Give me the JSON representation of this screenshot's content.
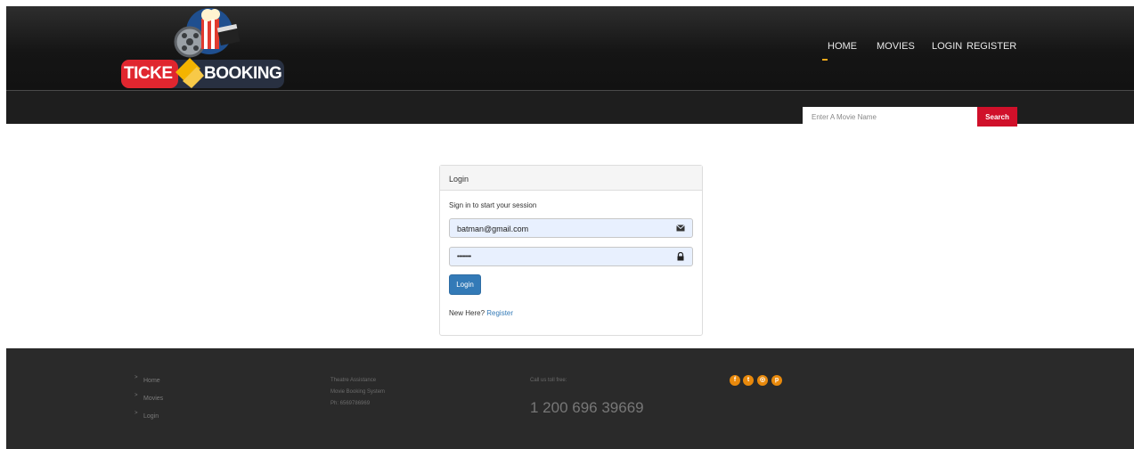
{
  "brand": {
    "logo_text_left": "TICKE",
    "logo_text_right": "BOOKING"
  },
  "nav": {
    "items": [
      "HOME",
      "MOVIES",
      "LOGIN",
      "REGISTER"
    ],
    "active": "HOME"
  },
  "search": {
    "placeholder": "Enter A Movie Name",
    "button_label": "Search"
  },
  "login_panel": {
    "title": "Login",
    "subtitle": "Sign in to start your session",
    "email_value": "batman@gmail.com",
    "password_value": "••••••••",
    "submit_label": "Login",
    "new_here_text": "New Here?",
    "register_link": "Register"
  },
  "footer": {
    "links": [
      "Home",
      "Movies",
      "Login"
    ],
    "info_lines": [
      "Theatre Assistance",
      "Movie Booking System",
      "Ph: 6569786969"
    ],
    "call_label": "Call us toll free:",
    "phone": "1 200 696 39669",
    "social_icons": [
      "facebook-icon",
      "twitter-icon",
      "dribbble-icon",
      "pinterest-icon"
    ]
  },
  "colors": {
    "accent": "#f0a81a",
    "search_button": "#d0102a",
    "login_button": "#337ab7",
    "social": "#e8890c"
  }
}
